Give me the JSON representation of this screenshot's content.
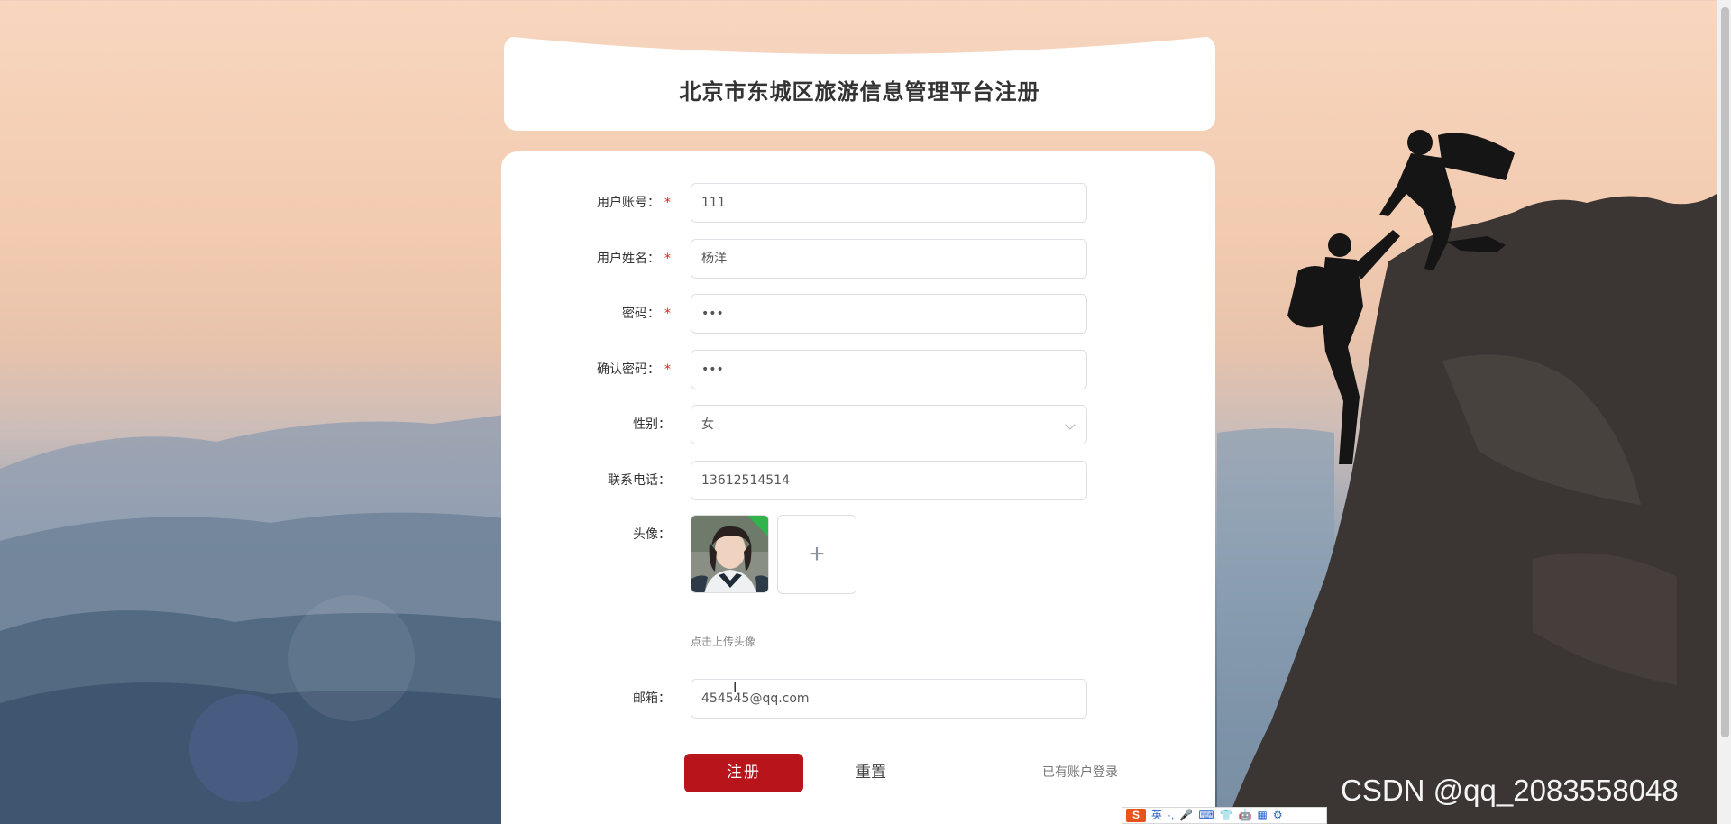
{
  "title": "北京市东城区旅游信息管理平台注册",
  "form": {
    "fields": [
      {
        "label": "用户账号：",
        "required": true,
        "value": "111",
        "type": "text"
      },
      {
        "label": "用户姓名：",
        "required": true,
        "value": "杨洋",
        "type": "text"
      },
      {
        "label": "密码：",
        "required": true,
        "value": "•••",
        "type": "password"
      },
      {
        "label": "确认密码：",
        "required": true,
        "value": "•••",
        "type": "password"
      },
      {
        "label": "性别：",
        "required": false,
        "value": "女",
        "type": "select"
      },
      {
        "label": "联系电话：",
        "required": false,
        "value": "13612514514",
        "type": "text"
      }
    ],
    "avatar": {
      "label": "头像：",
      "hint": "点击上传头像",
      "add_icon": "plus-icon"
    },
    "email": {
      "label": "邮箱：",
      "value": "454545@qq.com"
    },
    "required_mark": "*"
  },
  "actions": {
    "register": "注册",
    "reset": "重置",
    "login_link": "已有账户登录"
  },
  "colors": {
    "primary": "#b8141b",
    "required": "#e02020"
  },
  "watermark": "CSDN @qq_2083558048",
  "ime": {
    "logo": "S",
    "mode": "英",
    "items": [
      "·,",
      "🎤",
      "⌨",
      "👕",
      "🤖",
      "▦",
      "⚙"
    ]
  }
}
